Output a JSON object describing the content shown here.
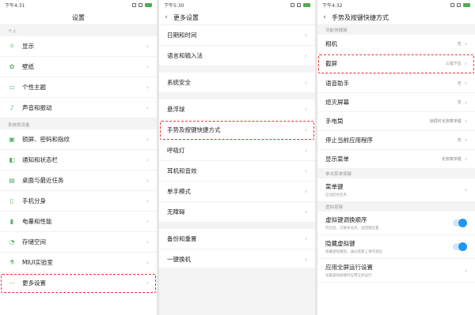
{
  "panel1": {
    "time": "下午4:31",
    "title": "设置",
    "section1": "个人",
    "items1": [
      {
        "label": "显示",
        "icon": "sun-icon"
      },
      {
        "label": "壁纸",
        "icon": "wallpaper-icon"
      },
      {
        "label": "个性主题",
        "icon": "theme-icon"
      },
      {
        "label": "声音和振动",
        "icon": "sound-icon"
      }
    ],
    "section2": "系统和设备",
    "items2": [
      {
        "label": "锁屏、密码和指纹",
        "icon": "lock-icon"
      },
      {
        "label": "通知和状态栏",
        "icon": "notification-icon"
      },
      {
        "label": "桌面与最近任务",
        "icon": "desktop-icon"
      },
      {
        "label": "手机分身",
        "icon": "clone-icon"
      },
      {
        "label": "电量和性能",
        "icon": "battery-icon"
      },
      {
        "label": "存储空间",
        "icon": "storage-icon"
      },
      {
        "label": "MIUI实验室",
        "icon": "lab-icon"
      },
      {
        "label": "更多设置",
        "icon": "more-icon"
      }
    ]
  },
  "panel2": {
    "time": "下午5:30",
    "title": "更多设置",
    "items": [
      "日期和时间",
      "语言和输入法",
      "系统安全",
      "悬浮球",
      "手势及按键快捷方式",
      "呼吸灯",
      "耳机和音效",
      "单手模式",
      "无障碍",
      "备份和重置",
      "一键换机"
    ]
  },
  "panel3": {
    "time": "下午4:32",
    "title": "手势及按键快捷方式",
    "section1": "功能快捷键",
    "items": [
      {
        "label": "相机",
        "value": "无"
      },
      {
        "label": "截屏",
        "value": "三指下拉"
      },
      {
        "label": "语音助手",
        "value": "无"
      },
      {
        "label": "熄灭屏幕",
        "value": "无"
      },
      {
        "label": "手电筒",
        "value": "锁屏时长按菜单键"
      },
      {
        "label": "停止当前应用程序",
        "value": "无"
      },
      {
        "label": "显示菜单",
        "value": "长按菜单键"
      }
    ],
    "section2": "单击菜单按键",
    "menu_key": {
      "label": "菜单键",
      "sub": "启动后台任务"
    },
    "section3": "虚拟按键",
    "virtual": [
      {
        "label": "虚拟键调换顺序",
        "sub": "开启后，交换多任务、返回键位置"
      },
      {
        "label": "隐藏虚拟键",
        "sub": "隐藏虚拟键后，通过底部上滑可调出"
      }
    ],
    "fullscreen": {
      "label": "应用全屏运行设置",
      "sub": "设置虚拟按键时应用全屏运行"
    }
  }
}
